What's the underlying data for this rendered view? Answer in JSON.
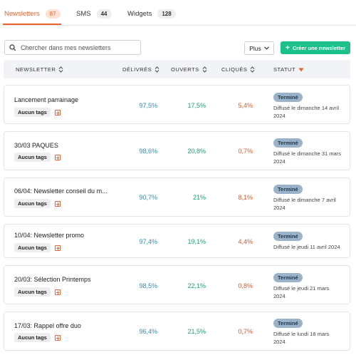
{
  "tabs": [
    {
      "label": "Newsletters",
      "count": "87"
    },
    {
      "label": "SMS",
      "count": "44"
    },
    {
      "label": "Widgets",
      "count": "128"
    }
  ],
  "toolbar": {
    "search_placeholder": "Chercher dans mes newsletters",
    "more_label": "Plus",
    "create_label": "Créer une newsletter"
  },
  "table": {
    "headers": {
      "newsletter": "NEWSLETTER",
      "delivered": "DÉLIVRÉS",
      "opened": "OUVERTS",
      "clicks": "CLIQUÉS",
      "status": "STATUT"
    },
    "rows": [
      {
        "name": "Lancement parrainage",
        "tag": "Aucun tags",
        "delivered": "97,5%",
        "opened": "17,5%",
        "clicks": "5,4%",
        "status": "Terminé",
        "sent_line1": "Diffusé le dimanche 14 avril",
        "sent_line2": "2024"
      },
      {
        "name": "30/03 PAQUES",
        "tag": "Aucun tags",
        "delivered": "98,6%",
        "opened": "20,8%",
        "clicks": "0,7%",
        "status": "Terminé",
        "sent_line1": "Diffusé le dimanche 31 mars",
        "sent_line2": "2024"
      },
      {
        "name": "06/04: Newsletter conseil du m...",
        "tag": "Aucun tags",
        "delivered": "90,7%",
        "opened": "21%",
        "clicks": "8,1%",
        "status": "Terminé",
        "sent_line1": "Diffusé le dimanche 7 avril",
        "sent_line2": "2024"
      },
      {
        "name": "10/04: Newsletter promo",
        "tag": "Aucun tags",
        "delivered": "97,4%",
        "opened": "19,1%",
        "clicks": "4,4%",
        "status": "Terminé",
        "sent_line1": "Diffusé le jeudi 11 avril 2024",
        "sent_line2": ""
      },
      {
        "name": "20/03: Sélection Printemps",
        "tag": "Aucun tags",
        "delivered": "98,5%",
        "opened": "22,1%",
        "clicks": "0,8%",
        "status": "Terminé",
        "sent_line1": "Diffusé le jeudi 21 mars",
        "sent_line2": "2024"
      },
      {
        "name": "17/03: Rappel offre duo",
        "tag": "Aucun tags",
        "delivered": "96,4%",
        "opened": "21,5%",
        "clicks": "0,7%",
        "status": "Terminé",
        "sent_line1": "Diffusé le lundi 18 mars",
        "sent_line2": "2024"
      }
    ]
  },
  "colors": {
    "accent": "#e8632b",
    "create_button": "#1cc08a",
    "delivered": "#2b8fc2",
    "opened": "#17a673",
    "clicks": "#e4572e",
    "status_badge": "#9bb3ca"
  }
}
